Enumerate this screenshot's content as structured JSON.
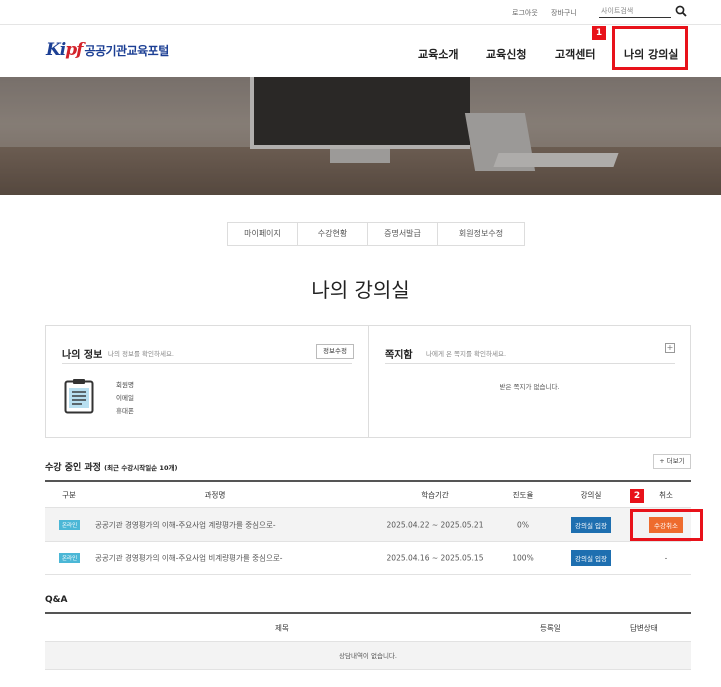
{
  "topbar": {
    "logout": "로그아웃",
    "cart": "장바구니",
    "search_placeholder": "사이트검색"
  },
  "brand": {
    "mark_a": "Ki",
    "mark_b": "pf",
    "name": "공공기관교육포털",
    "color": "#1c3f94"
  },
  "nav": [
    "교육소개",
    "교육신청",
    "고객센터",
    "나의 강의실"
  ],
  "annotations": {
    "step1": "1",
    "step2": "2",
    "color": "#e8121a"
  },
  "subtabs": [
    "마이페이지",
    "수강현황",
    "증명서발급",
    "회원정보수정"
  ],
  "page_title": "나의 강의실",
  "my_info": {
    "title": "나의 정보",
    "desc": "나의 정보를 확인하세요.",
    "edit_button": "정보수정",
    "lines": [
      "회원명",
      "이메일",
      "휴대폰"
    ]
  },
  "inbox": {
    "title": "쪽지함",
    "desc": "나에게 온 쪽지를 확인하세요.",
    "empty": "받은 쪽지가 없습니다."
  },
  "courses": {
    "title": "수강 중인 과정",
    "subtitle": "(최근 수강시작일순 10개)",
    "more": "+ 더보기",
    "headers": [
      "구분",
      "과정명",
      "학습기간",
      "진도율",
      "강의실",
      "취소"
    ],
    "rows": [
      {
        "type": "온라인",
        "name": "공공기관 경영평가의 이해-주요사업 계량평가를 중심으로-",
        "period": "2025.04.22 ~ 2025.05.21",
        "progress": "0%",
        "room": "강의실 입장",
        "cancel": "수강취소"
      },
      {
        "type": "온라인",
        "name": "공공기관 경영평가의 이해-주요사업 비계량평가를 중심으로-",
        "period": "2025.04.16 ~ 2025.05.15",
        "progress": "100%",
        "room": "강의실 입장",
        "cancel": "-"
      }
    ]
  },
  "qa": {
    "title": "Q&A",
    "headers": [
      "제목",
      "등록일",
      "답변상태"
    ],
    "empty": "상담내역이 없습니다."
  }
}
